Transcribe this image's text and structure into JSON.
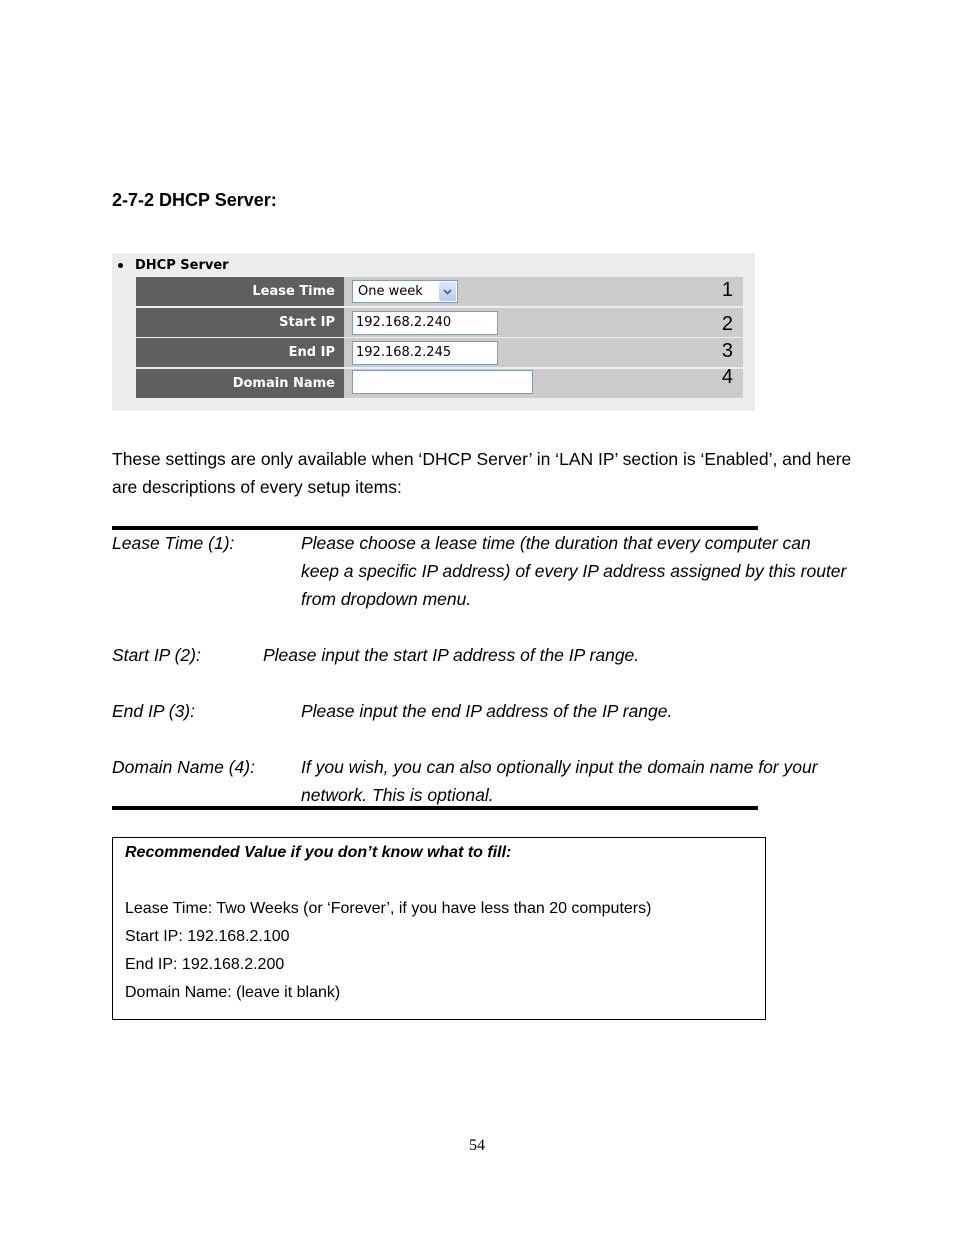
{
  "heading": "2-7-2 DHCP Server:",
  "panel": {
    "title": "DHCP Server",
    "rows": [
      {
        "label": "Lease Time",
        "type": "select",
        "value": "One week",
        "number": "1"
      },
      {
        "label": "Start IP",
        "type": "text",
        "value": "192.168.2.240",
        "number": "2"
      },
      {
        "label": "End IP",
        "type": "text",
        "value": "192.168.2.245",
        "number": "3"
      },
      {
        "label": "Domain Name",
        "type": "text",
        "value": "",
        "number": "4"
      }
    ]
  },
  "intro": "These settings are only available when ‘DHCP Server’ in ‘LAN IP’ section is ‘Enabled’, and here are descriptions of every setup items:",
  "descriptions": [
    {
      "term": "Lease Time (1):",
      "definition": "Please choose a lease time (the duration that every computer can keep a specific IP address) of every IP address assigned by this router from dropdown menu."
    },
    {
      "term": "Start IP (2):",
      "definition": "Please input the start IP address of the IP range."
    },
    {
      "term": "End IP (3):",
      "definition": "Please input the end IP address of the IP range."
    },
    {
      "term": "Domain Name (4):",
      "definition": "If you wish, you can also optionally input the domain name for your network. This is optional."
    }
  ],
  "recommended": {
    "title": "Recommended Value if you don’t know what to fill:",
    "lines": [
      "Lease Time: Two Weeks (or ‘Forever’, if you have less than 20 computers)",
      "Start IP: 192.168.2.100",
      "End IP: 192.168.2.200",
      "Domain Name: (leave it blank)"
    ]
  },
  "page_number": "54"
}
